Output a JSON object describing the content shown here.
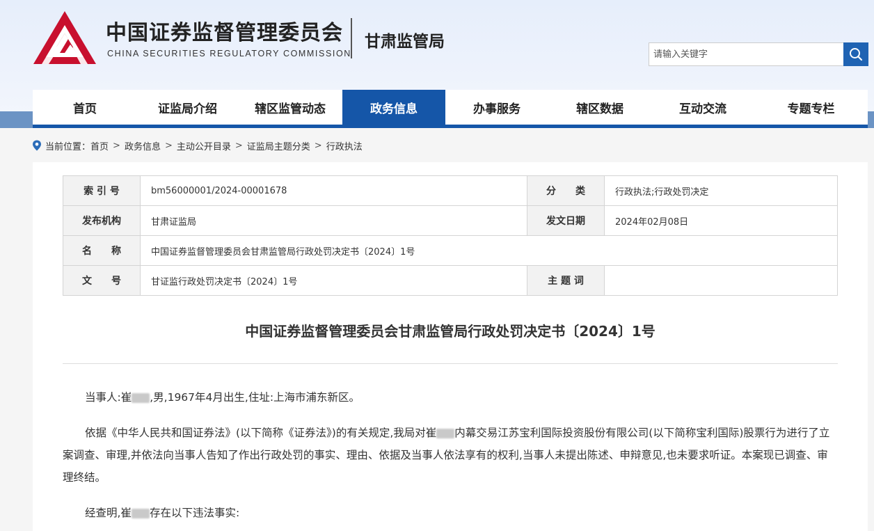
{
  "header": {
    "org_cn": "中国证券监督管理委员会",
    "org_en": "CHINA SECURITIES REGULATORY COMMISSION",
    "bureau": "甘肃监管局",
    "search_placeholder": "请输入关键字",
    "brand_color": "#c8102e",
    "nav_color": "#1556a8"
  },
  "nav": {
    "items": [
      {
        "label": "首页"
      },
      {
        "label": "证监局介绍"
      },
      {
        "label": "辖区监管动态"
      },
      {
        "label": "政务信息",
        "active": true
      },
      {
        "label": "办事服务"
      },
      {
        "label": "辖区数据"
      },
      {
        "label": "互动交流"
      },
      {
        "label": "专题专栏"
      }
    ]
  },
  "breadcrumb": {
    "prefix": "当前位置：",
    "items": [
      "首页",
      "政务信息",
      "主动公开目录",
      "证监局主题分类",
      "行政执法"
    ]
  },
  "meta": {
    "index_label": "索 引 号",
    "index_value": "bm56000001/2024-00001678",
    "category_label": "分　　类",
    "category_value": "行政执法;行政处罚决定",
    "issuer_label": "发布机构",
    "issuer_value": "甘肃证监局",
    "date_label": "发文日期",
    "date_value": "2024年02月08日",
    "name_label": "名　　称",
    "name_value": "中国证券监督管理委员会甘肃监管局行政处罚决定书〔2024〕1号",
    "docno_label": "文　　号",
    "docno_value": "甘证监行政处罚决定书〔2024〕1号",
    "keyword_label": "主 题 词",
    "keyword_value": ""
  },
  "document": {
    "title": "中国证券监督管理委员会甘肃监管局行政处罚决定书〔2024〕1号",
    "p1_a": "当事人:崔",
    "p1_b": ",男,1967年4月出生,住址:上海市浦东新区。",
    "p2_a": "依据《中华人民共和国证券法》(以下简称《证券法》)的有关规定,我局对崔",
    "p2_b": "内幕交易江苏宝利国际投资股份有限公司(以下简称宝利国际)股票行为进行了立案调查、审理,并依法向当事人告知了作出行政处罚的事实、理由、依据及当事人依法享有的权利,当事人未提出陈述、申辩意见,也未要求听证。本案现已调查、审理终结。",
    "p3_a": "经查明,崔",
    "p3_b": "存在以下违法事实:"
  }
}
